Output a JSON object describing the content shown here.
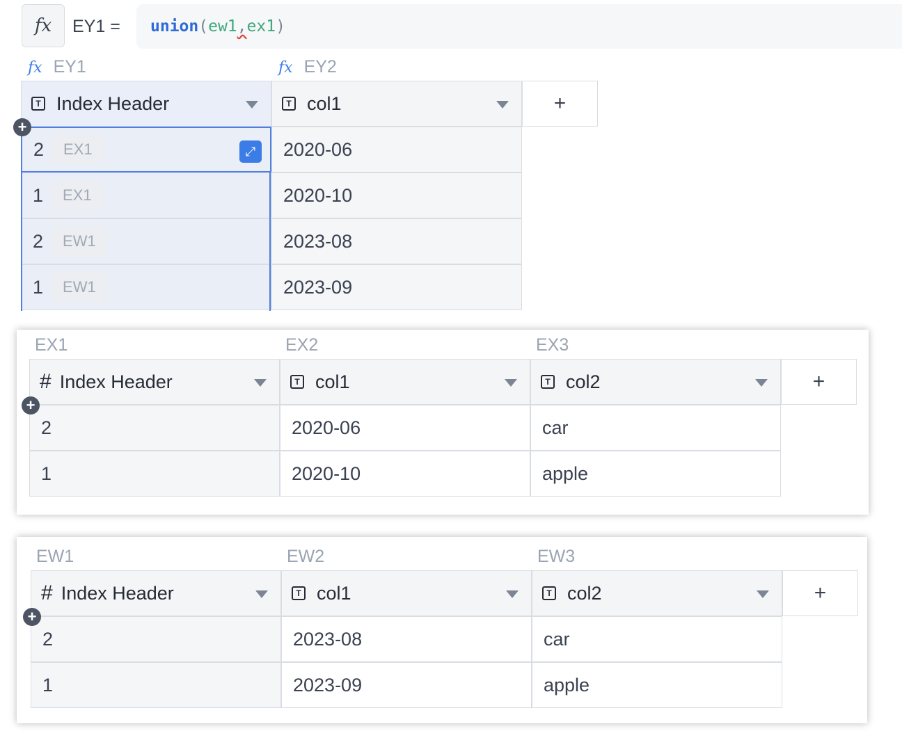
{
  "formula": {
    "fx_icon": "fx",
    "name": "EY1 =",
    "function": "union",
    "open_paren": "(",
    "arg1": "ew1",
    "comma": ",",
    "arg2": "ex1",
    "close_paren": ")"
  },
  "ey": {
    "col_names": [
      "EY1",
      "EY2"
    ],
    "headers": [
      "Index Header",
      "col1"
    ],
    "rows": [
      {
        "index": "2",
        "ref": "EX1",
        "col1": "2020-06"
      },
      {
        "index": "1",
        "ref": "EX1",
        "col1": "2020-10"
      },
      {
        "index": "2",
        "ref": "EW1",
        "col1": "2023-08"
      },
      {
        "index": "1",
        "ref": "EW1",
        "col1": "2023-09"
      }
    ]
  },
  "ex": {
    "col_names": [
      "EX1",
      "EX2",
      "EX3"
    ],
    "headers": [
      "Index Header",
      "col1",
      "col2"
    ],
    "rows": [
      {
        "index": "2",
        "col1": "2020-06",
        "col2": "car"
      },
      {
        "index": "1",
        "col1": "2020-10",
        "col2": "apple"
      }
    ]
  },
  "ew": {
    "col_names": [
      "EW1",
      "EW2",
      "EW3"
    ],
    "headers": [
      "Index Header",
      "col1",
      "col2"
    ],
    "rows": [
      {
        "index": "2",
        "col1": "2023-08",
        "col2": "car"
      },
      {
        "index": "1",
        "col1": "2023-09",
        "col2": "apple"
      }
    ]
  },
  "glyphs": {
    "plus": "+",
    "add_row": "+",
    "text_type": "T",
    "number_type": "#",
    "expand": "⤢"
  }
}
